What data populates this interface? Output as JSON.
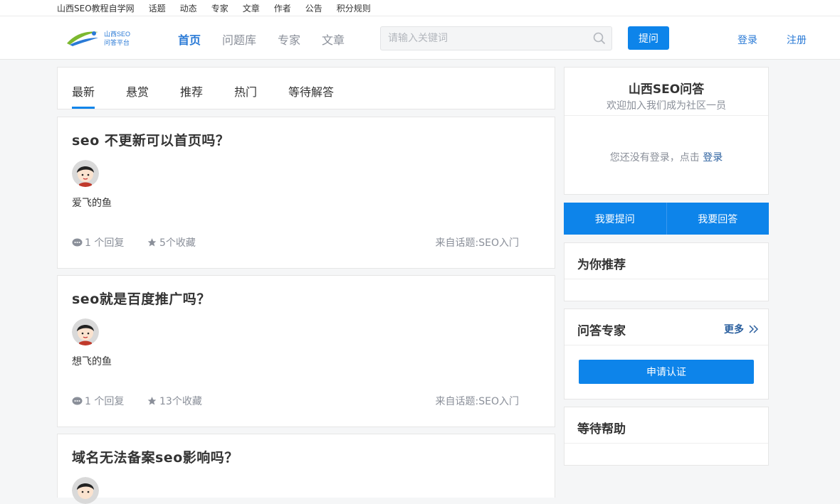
{
  "topbar": {
    "links": [
      "山西SEO教程自学网",
      "话题",
      "动态",
      "专家",
      "文章",
      "作者",
      "公告",
      "积分规则"
    ]
  },
  "header": {
    "logo_text_top": "山西SEO",
    "logo_text_bottom": "问答平台",
    "nav": [
      "首页",
      "问题库",
      "专家",
      "文章"
    ],
    "nav_active": "首页",
    "search_placeholder": "请输入关键词",
    "ask_label": "提问",
    "login_label": "登录",
    "register_label": "注册"
  },
  "tabs": [
    "最新",
    "悬赏",
    "推荐",
    "热门",
    "等待解答"
  ],
  "tabs_active": "最新",
  "questions": [
    {
      "title": "seo 不更新可以首页吗？",
      "author": "爱飞的鱼",
      "replies": "1 个回复",
      "favorites": "5个收藏",
      "topic": "来自话题:SEO入门"
    },
    {
      "title": "seo就是百度推广吗？",
      "author": "想飞的鱼",
      "replies": "1 个回复",
      "favorites": "13个收藏",
      "topic": "来自话题:SEO入门"
    },
    {
      "title": "域名无法备案seo影响吗？",
      "author": "",
      "replies": "",
      "favorites": "",
      "topic": ""
    }
  ],
  "sidebar": {
    "welcome_title": "山西SEO问答",
    "welcome_subtitle": "欢迎加入我们成为社区一员",
    "login_prompt": "您还没有登录，点击",
    "login_link": "登录",
    "ask_button": "我要提问",
    "answer_button": "我要回答",
    "recommend_title": "为你推荐",
    "experts_title": "问答专家",
    "more_label": "更多",
    "apply_button": "申请认证",
    "waiting_title": "等待帮助"
  },
  "colors": {
    "accent": "#0d84ea",
    "link": "#2a7ad6",
    "muted": "#8a8f99"
  }
}
